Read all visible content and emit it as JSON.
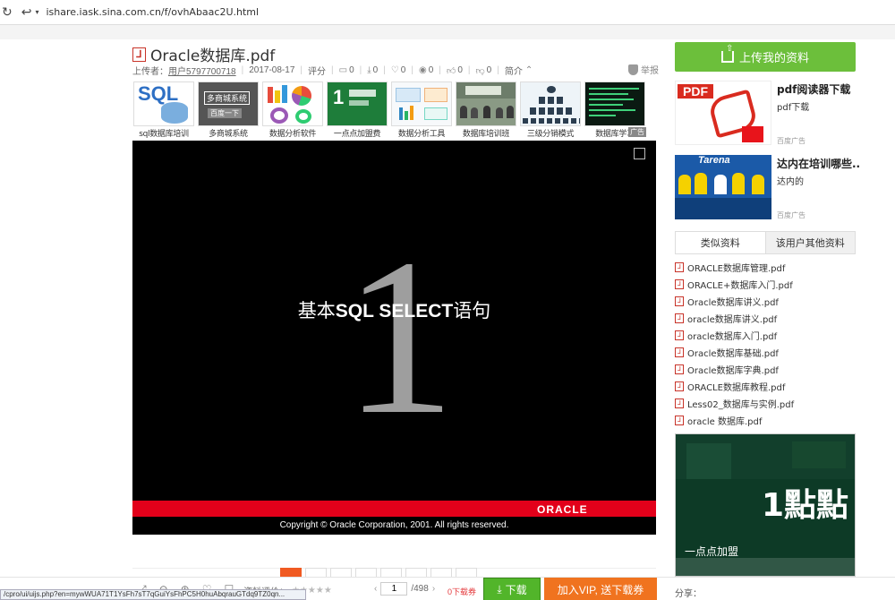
{
  "browser": {
    "url": "ishare.iask.sina.com.cn/f/ovhAbaac2U.html"
  },
  "document": {
    "title": "Oracle数据库.pdf",
    "uploader_label": "上传者：",
    "uploader": "用户5797700718",
    "date": "2017-08-17",
    "rating_label": "评分",
    "comments": "0",
    "downloads": "0",
    "favorites": "0",
    "views": "0",
    "likes": "0",
    "dislikes": "0",
    "intro_label": "简介",
    "report_label": "举报"
  },
  "ads_strip": {
    "items": [
      {
        "caption": "sql数据库培训",
        "img_text": "SQL"
      },
      {
        "caption": "多商城系统",
        "img_text": "多商城系统"
      },
      {
        "caption": "数据分析软件",
        "img_text": ""
      },
      {
        "caption": "一点点加盟费",
        "img_text": ""
      },
      {
        "caption": "数据分析工具",
        "img_text": ""
      },
      {
        "caption": "数据库培训班",
        "img_text": ""
      },
      {
        "caption": "三级分销模式",
        "img_text": ""
      },
      {
        "caption": "数据库学习",
        "img_text": ""
      }
    ],
    "ad_tag": "广告",
    "search_tag": "百度一下"
  },
  "slide": {
    "big_number": "1",
    "title_cn": "基本",
    "title_en": "SQL SELECT",
    "title_cn2": "语句",
    "brand": "ORACLE",
    "copyright": "Copyright © Oracle Corporation, 2001. All rights reserved."
  },
  "toolbar": {
    "rate_label": "资料评价：",
    "current_page": "1",
    "total_pages": "/498",
    "download_count": "0下载券",
    "download_label": "下载",
    "vip_label": "加入VIP, 送下载券",
    "share_label": "分享："
  },
  "statusbar": {
    "url": "/cpro/ui/uijs.php?en=mywWUA71T1YsFh7sT7qGuiYsFhPC5H0huAbqrauGTdq9TZ0qn..."
  },
  "sidebar": {
    "upload_label": "上传我的资料",
    "ads": [
      {
        "title": "pdf阅读器下载",
        "sub": "pdf下载",
        "source": "百度广告",
        "thumb_text": "PDF"
      },
      {
        "title": "达内在培训哪些..",
        "sub": "达内的",
        "source": "百度广告",
        "thumb_text": "Tarena"
      }
    ],
    "tabs": [
      "类似资料",
      "该用户其他资料"
    ],
    "related": [
      "ORACLE数据库管理.pdf",
      "ORACLE+数据库入门.pdf",
      "Oracle数据库讲义.pdf",
      "oracle数据库讲义.pdf",
      "oracle数据库入门.pdf",
      "Oracle数据库基础.pdf",
      "Oracle数据库字典.pdf",
      "ORACLE数据库教程.pdf",
      "Less02_数据库与实例.pdf",
      "oracle 数据库.pdf"
    ],
    "bottom_ad_mark": "1點點",
    "bottom_ad_caption": "一点点加盟"
  },
  "colors": {
    "accent_green": "#6cbf3b",
    "oracle_red": "#e2001a",
    "vip_orange": "#f0731f"
  }
}
